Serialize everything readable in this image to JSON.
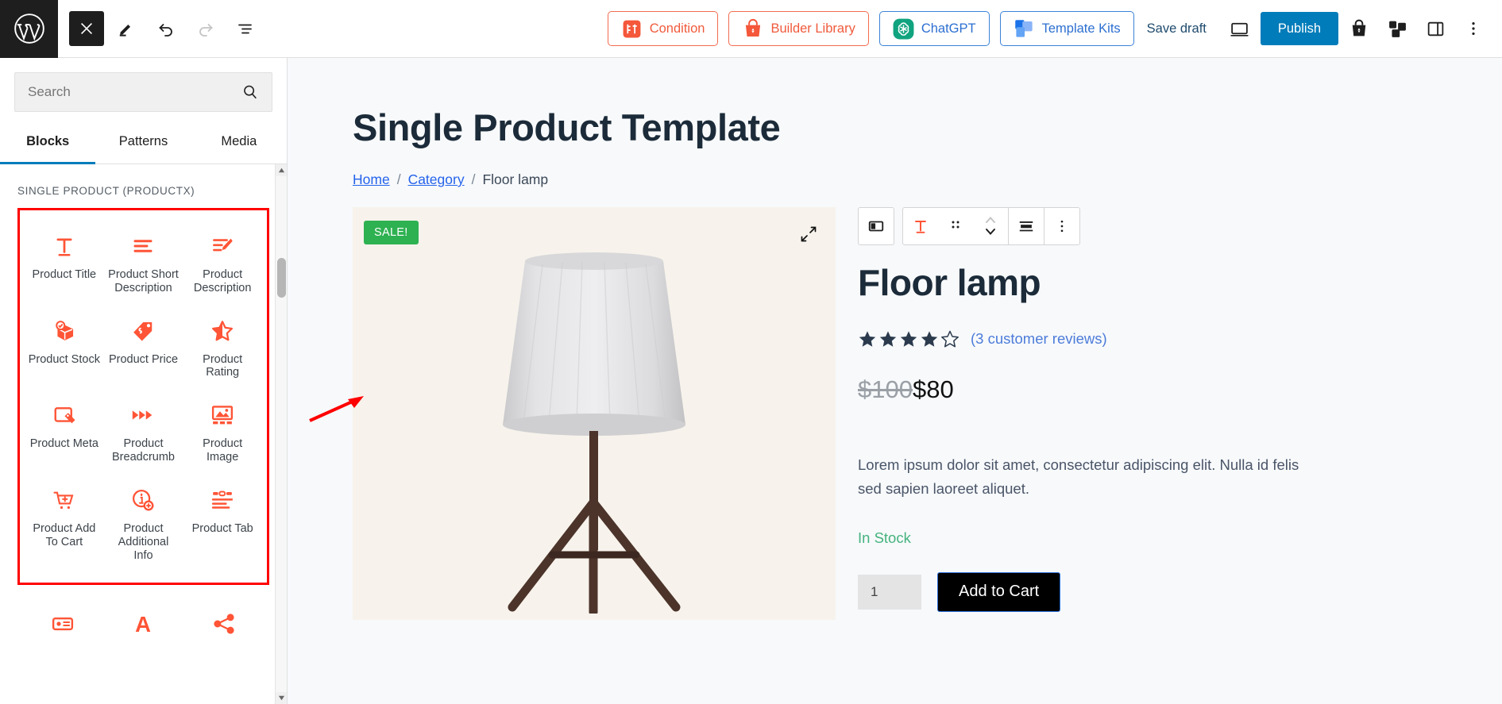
{
  "app": {
    "logo_icon": "wordpress-logo-icon"
  },
  "topbar": {
    "close_label": "×",
    "icons": {
      "close": "close-icon",
      "edit": "pencil-edit-icon",
      "undo": "undo-arrow-icon",
      "redo": "redo-arrow-icon",
      "list_view": "list-view-icon",
      "preview": "desktop-preview-icon",
      "cart": "woocommerce-bag-icon",
      "blocks": "blocks-grid-icon",
      "settings_panel": "sidebar-panel-icon",
      "more": "three-dots-vertical-icon"
    },
    "buttons": [
      {
        "label": "Condition",
        "icon": "condition-icon",
        "style": "orange"
      },
      {
        "label": "Builder Library",
        "icon": "builder-library-bag-icon",
        "style": "orange"
      },
      {
        "label": "ChatGPT",
        "icon": "chatgpt-icon",
        "style": "blue"
      },
      {
        "label": "Template Kits",
        "icon": "template-kits-icon",
        "style": "blue"
      }
    ],
    "save_draft_label": "Save draft",
    "publish_label": "Publish",
    "publish_color": "#007cba"
  },
  "sidebar": {
    "search": {
      "placeholder": "Search",
      "value": "",
      "icon": "search-icon"
    },
    "tabs": [
      {
        "label": "Blocks",
        "active": true
      },
      {
        "label": "Patterns",
        "active": false
      },
      {
        "label": "Media",
        "active": false
      }
    ],
    "category_title": "SINGLE PRODUCT (PRODUCTX)",
    "highlight_color": "#ff0000",
    "block_icon_color": "#ff5436",
    "blocks": [
      {
        "label": "Product Title",
        "icon": "product-title-icon"
      },
      {
        "label": "Product Short Description",
        "icon": "product-short-description-icon"
      },
      {
        "label": "Product Description",
        "icon": "product-description-icon"
      },
      {
        "label": "Product Stock",
        "icon": "product-stock-box-icon"
      },
      {
        "label": "Product Price",
        "icon": "product-price-tag-icon"
      },
      {
        "label": "Product Rating",
        "icon": "product-rating-star-icon"
      },
      {
        "label": "Product Meta",
        "icon": "product-meta-icon"
      },
      {
        "label": "Product Breadcrumb",
        "icon": "product-breadcrumb-icon"
      },
      {
        "label": "Product Image",
        "icon": "product-image-icon"
      },
      {
        "label": "Product Add To Cart",
        "icon": "product-add-to-cart-icon"
      },
      {
        "label": "Product Additional Info",
        "icon": "product-additional-info-icon"
      },
      {
        "label": "Product Tab",
        "icon": "product-tab-icon"
      }
    ],
    "blocks_overflow": [
      {
        "label": "",
        "icon": "product-gallery-icon"
      },
      {
        "label": "",
        "icon": "text-letter-a-icon"
      },
      {
        "label": "",
        "icon": "share-icon"
      }
    ]
  },
  "canvas": {
    "page_title": "Single Product Template",
    "breadcrumb": {
      "items": [
        {
          "label": "Home",
          "link": true
        },
        {
          "label": "Category",
          "link": true
        },
        {
          "label": "Floor lamp",
          "link": false
        }
      ],
      "separator": "/"
    },
    "block_toolbar": {
      "icons": [
        "column-layout-icon",
        "product-title-block-icon",
        "drag-handle-icon",
        "move-up-down-icon",
        "align-icon",
        "options-three-dots-icon"
      ]
    },
    "product": {
      "image": {
        "sale_badge": "SALE!",
        "sale_badge_color": "#2eb151",
        "expand_icon": "expand-fullscreen-icon",
        "alt": "floor-lamp-product-image",
        "background": "#f7f3ec"
      },
      "name": "Floor lamp",
      "rating": {
        "value": 4,
        "max": 5,
        "reviews_label": "(3 customer reviews)"
      },
      "price": {
        "old": "$100",
        "current": "$80"
      },
      "description": "Lorem ipsum dolor sit amet, consectetur adipiscing elit. Nulla id felis sed sapien laoreet aliquet.",
      "stock_status": "In Stock",
      "stock_color": "#45b37e",
      "quantity": "1",
      "add_to_cart_label": "Add to Cart"
    }
  }
}
